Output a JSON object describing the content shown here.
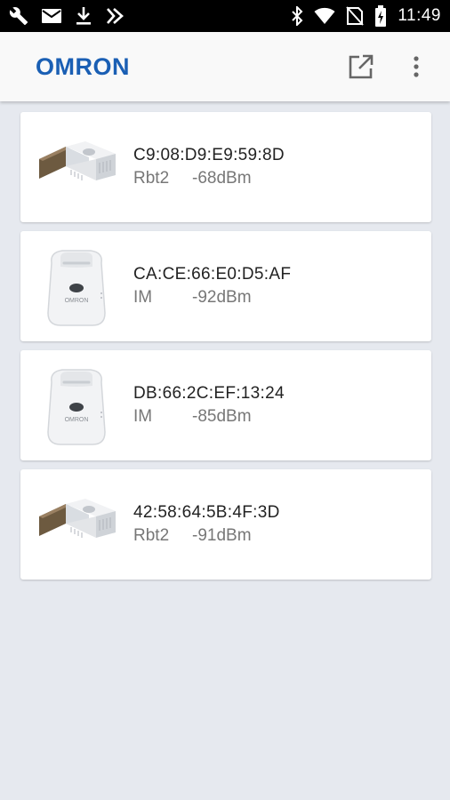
{
  "status_bar": {
    "time": "11:49",
    "left_icons": [
      "wrench-icon",
      "mail-icon",
      "download-icon",
      "checkmark-icon"
    ],
    "right_icons": [
      "bluetooth-icon",
      "wifi-icon",
      "no-sim-icon",
      "battery-charging-icon"
    ]
  },
  "app_bar": {
    "logo": "OMRON",
    "actions": [
      "open-external-icon",
      "more-vert-icon"
    ]
  },
  "devices": [
    {
      "mac": "C9:08:D9:E9:59:8D",
      "type": "Rbt2",
      "rssi": "-68dBm",
      "image": "usb-dongle-sensor"
    },
    {
      "mac": "CA:CE:66:E0:D5:AF",
      "type": "IM",
      "rssi": "-92dBm",
      "image": "bag-shaped-sensor"
    },
    {
      "mac": "DB:66:2C:EF:13:24",
      "type": "IM",
      "rssi": "-85dBm",
      "image": "bag-shaped-sensor"
    },
    {
      "mac": "42:58:64:5B:4F:3D",
      "type": "Rbt2",
      "rssi": "-91dBm",
      "image": "usb-dongle-sensor"
    }
  ]
}
